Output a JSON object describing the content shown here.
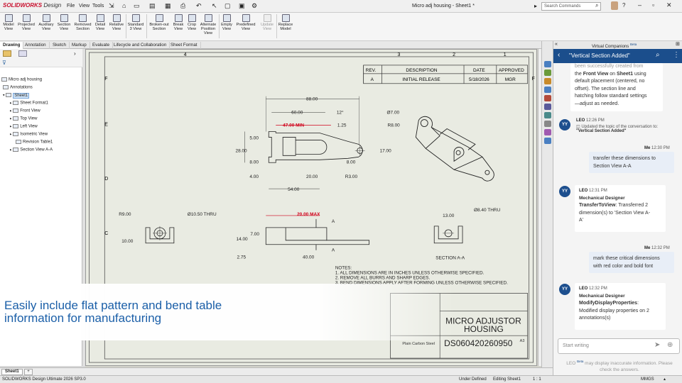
{
  "app": {
    "logo_brand": "SOLIDWORKS",
    "logo_suffix": "Design",
    "doc_title": "Micro adj housing - Sheet1 *",
    "search_placeholder": "Search Commands"
  },
  "menus": [
    "File",
    "View",
    "Tools"
  ],
  "ribbon": [
    {
      "l1": "Model",
      "l2": "View"
    },
    {
      "l1": "Projected",
      "l2": "View"
    },
    {
      "l1": "Auxiliary",
      "l2": "View"
    },
    {
      "l1": "Section",
      "l2": "View"
    },
    {
      "l1": "Removed",
      "l2": "Section"
    },
    {
      "l1": "Detail",
      "l2": "View"
    },
    {
      "l1": "Relative",
      "l2": "View"
    },
    {
      "l1": "Standard",
      "l2": "3 View"
    },
    {
      "l1": "Broken-out",
      "l2": "Section"
    },
    {
      "l1": "Break",
      "l2": "View"
    },
    {
      "l1": "Crop",
      "l2": "View"
    },
    {
      "l1": "Alternate",
      "l2": "Position",
      "l3": "View"
    },
    {
      "l1": "Empty",
      "l2": "View"
    },
    {
      "l1": "Predefined",
      "l2": "View"
    },
    {
      "l1": "Update",
      "l2": "View"
    },
    {
      "l1": "Replace",
      "l2": "Model"
    }
  ],
  "tabs": [
    "Drawing",
    "Annotation",
    "Sketch",
    "Markup",
    "Evaluate",
    "Lifecycle and Collaboration",
    "Sheet Format"
  ],
  "tree": {
    "root": "Micro adj housing",
    "items": [
      "Annotations",
      "Sheet1",
      "Sheet Format1",
      "Front View",
      "Top View",
      "Left View",
      "Isometric View",
      "Revision Table1",
      "Section View A-A"
    ]
  },
  "sheet": {
    "cols": [
      "4",
      "3",
      "2",
      "1"
    ],
    "rows": [
      "F",
      "E",
      "D",
      "C"
    ],
    "revtable": {
      "headers": [
        "REV.",
        "DESCRIPTION",
        "DATE",
        "APPROVED"
      ],
      "row": [
        "A",
        "INITIAL RELEASE",
        "5/18/2026",
        "MGR"
      ]
    },
    "dims": {
      "d88": "88.00",
      "d60": "60.00",
      "d12": "12°",
      "d7": "Ø7.00",
      "d47": "47.00 MIN",
      "d125": "1.25",
      "r8": "R8.00",
      "d5": "5.00",
      "d28": "28.00",
      "d8a": "8.00",
      "d17": "17.00",
      "d8b": "8.00",
      "d4": "4.00",
      "d20": "20.00",
      "r3": "R3.00",
      "d54": "54.00",
      "r9": "R9.00",
      "d105": "Ø10.50 THRU",
      "d10": "10.00",
      "d20max": "20.00 MAX",
      "d7b": "7.00",
      "d14": "14.00",
      "d275": "2.75",
      "d40": "40.00",
      "d13": "13.00",
      "d84": "Ø8.40 THRU",
      "secA1": "A",
      "secA2": "A",
      "section": "SECTION A-A"
    },
    "notes": [
      "NOTES:",
      "1.     ALL DIMENSIONS ARE IN INCHES UNLESS OTHERWISE SPECIFIED.",
      "2.     REMOVE ALL BURRS AND SHARP EDGES.",
      "3.     BEND DIMENSIONS APPLY AFTER FORMING UNLESS OTHERWISE SPECIFIED."
    ],
    "titleblock": {
      "name": "MICRO ADJUSTOR HOUSING",
      "name1": "MICRO ADJUSTOR",
      "name2": "HOUSING",
      "material": "Plain Carbon Steel",
      "dwgno": "DS060420260950",
      "size": "A3"
    }
  },
  "banner": {
    "line1": "Easily include flat pattern and bend table",
    "line2": "information for manufacturing"
  },
  "bottom": {
    "sheet_tab": "Sheet1"
  },
  "status": {
    "product": "SOLIDWORKS Design Ultimate 2026 SP3.0",
    "defined": "Under Defined",
    "editing": "Editing Sheet1",
    "scale": "1 : 1",
    "units": "MMGS"
  },
  "vc": {
    "panel_title": "Virtual Companions",
    "panel_badge": "Beta",
    "conv_title": "\"Vertical Section Added\"",
    "intro_line0": "been successfully created from",
    "intro_pre": "the ",
    "intro_b1": "Front View",
    "intro_mid": " on ",
    "intro_b2": "Sheet1",
    "intro_post": " using",
    "intro_line2": "default placement (centered, no",
    "intro_line3": "offset). The section line and",
    "intro_line4": "hatching follow standard settings",
    "intro_line5": "—adjust as needed.",
    "sys": {
      "who": "LEO",
      "time": "12:26 PM",
      "text1": "Updated the topic of the conversation to:",
      "text2": "\"Vertical Section Added\""
    },
    "m1": {
      "who": "Me",
      "time": "12:30 PM",
      "line1": "transfer these dimensions to",
      "line2": "Section View A-A"
    },
    "m2": {
      "who": "LEO",
      "time": "12:31 PM",
      "role": "Mechanical Designer",
      "action": "TransferToView",
      "line1": ": Transferred 2",
      "line2": "dimension(s) to 'Section View A-",
      "line3": "A'"
    },
    "m3": {
      "who": "Me",
      "time": "12:32 PM",
      "line1": "mark these critical dimensions",
      "line2": "with red color and bold font"
    },
    "m4": {
      "who": "LEO",
      "time": "12:32 PM",
      "role": "Mechanical Designer",
      "action": "ModifyDisplayProperties",
      "line1": ":",
      "line2": "Modified display properties on 2",
      "line3": "annotations(s)"
    },
    "input_placeholder": "Start writing",
    "disc_name": "LEO",
    "disc_badge": "Beta",
    "disc_line1": "may display inaccurate information. Please",
    "disc_line2": "check the answers."
  },
  "colors": {
    "accent": "#1b4e8c",
    "red_dim": "#d0021b",
    "banner_text": "#1b5fa8"
  }
}
